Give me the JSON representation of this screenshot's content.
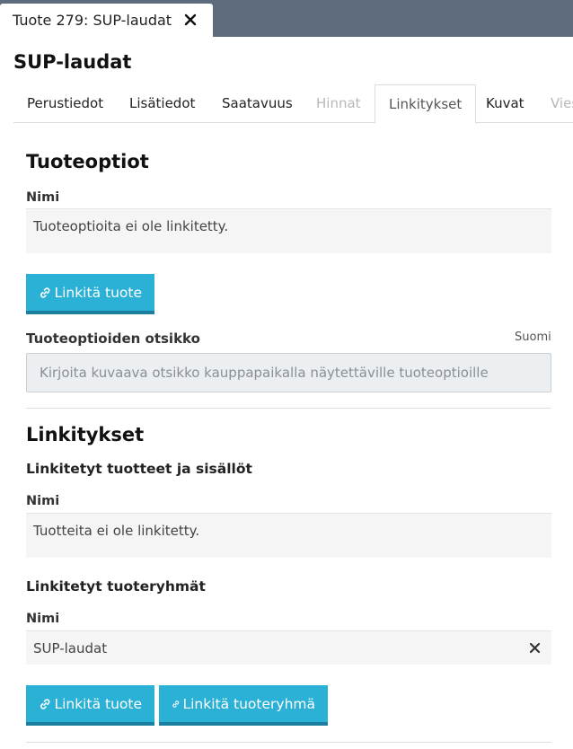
{
  "window_tab": {
    "title": "Tuote 279: SUP-laudat"
  },
  "page": {
    "title": "SUP-laudat"
  },
  "subtabs": [
    {
      "label": "Perustiedot"
    },
    {
      "label": "Lisätiedot"
    },
    {
      "label": "Saatavuus"
    },
    {
      "label": "Hinnat"
    },
    {
      "label": "Linkitykset"
    },
    {
      "label": "Kuvat"
    },
    {
      "label": "Vies"
    }
  ],
  "tuoteoptiot": {
    "title": "Tuoteoptiot",
    "column": "Nimi",
    "empty_text": "Tuoteoptioita ei ole linkitetty.",
    "link_button": "Linkitä tuote",
    "heading_field_label": "Tuoteoptioiden otsikko",
    "language": "Suomi",
    "heading_field_placeholder": "Kirjoita kuvaava otsikko kauppapaikalla näytettäville tuoteoptioille"
  },
  "linkitykset": {
    "title": "Linkitykset",
    "products": {
      "subtitle": "Linkitetyt tuotteet ja sisällöt",
      "column": "Nimi",
      "empty_text": "Tuotteita ei ole linkitetty."
    },
    "groups": {
      "subtitle": "Linkitetyt tuoteryhmät",
      "column": "Nimi",
      "rows": [
        {
          "name": "SUP-laudat"
        }
      ]
    },
    "link_product_button": "Linkitä tuote",
    "link_group_button": "Linkitä tuoteryhmä"
  },
  "colors": {
    "accent": "#2bb0d6",
    "accent_dark": "#1b7f9f",
    "header": "#5d6b7c"
  },
  "icons": {
    "close": "close-icon",
    "link": "link-icon",
    "remove": "remove-icon"
  }
}
